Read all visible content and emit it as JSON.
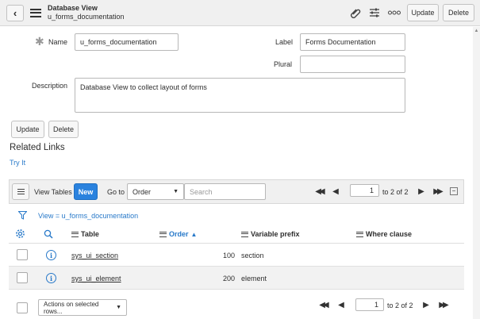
{
  "header": {
    "title": "Database View",
    "subtitle": "u_forms_documentation",
    "update_label": "Update",
    "delete_label": "Delete"
  },
  "form": {
    "name_label": "Name",
    "name_value": "u_forms_documentation",
    "label_label": "Label",
    "label_value": "Forms Documentation",
    "plural_label": "Plural",
    "plural_value": "",
    "description_label": "Description",
    "description_value": "Database View to collect layout of forms",
    "update_label": "Update",
    "delete_label": "Delete"
  },
  "related_links": {
    "heading": "Related Links",
    "try_it": "Try It"
  },
  "list": {
    "tab_label": "View Tables",
    "new_label": "New",
    "goto_label": "Go to",
    "goto_select": "Order",
    "search_placeholder": "Search",
    "page_value": "1",
    "page_of": "to 2 of 2",
    "filter_text": "View = u_forms_documentation",
    "columns": {
      "table": "Table",
      "order": "Order",
      "variable_prefix": "Variable prefix",
      "where_clause": "Where clause"
    },
    "rows": [
      {
        "table": "sys_ui_section",
        "order": "100",
        "prefix": "section",
        "where": ""
      },
      {
        "table": "sys_ui_element",
        "order": "200",
        "prefix": "element",
        "where": ""
      }
    ],
    "actions_select": "Actions on selected rows...",
    "footer_page_value": "1",
    "footer_page_of": "to 2 of 2"
  },
  "colors": {
    "header_bg": "#f0f0f0",
    "link": "#2879c9",
    "new_button": "#2a82de",
    "row_alt": "#f2f2f2"
  }
}
